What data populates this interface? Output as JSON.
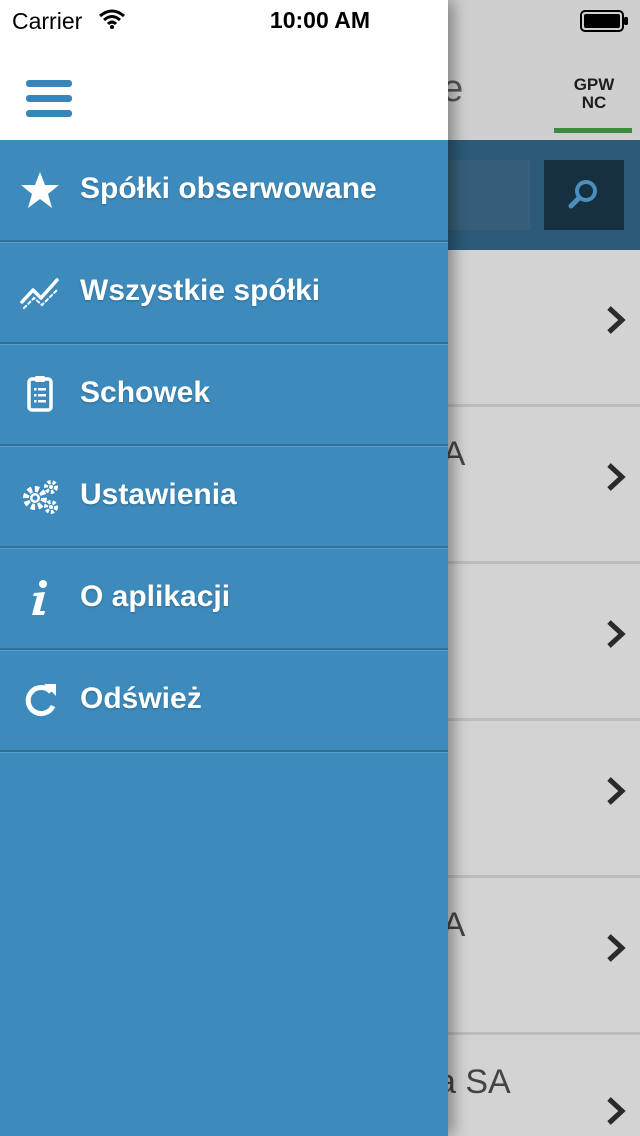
{
  "status_bar": {
    "carrier": "Carrier",
    "time": "10:00 AM"
  },
  "background": {
    "title_fragment": "ne",
    "market_tab": {
      "line1": "GPW",
      "line2": "NC"
    },
    "rows": [
      {
        "name_fragment": ""
      },
      {
        "name_fragment": "SA"
      },
      {
        "name_fragment": ""
      },
      {
        "name_fragment": ""
      },
      {
        "name_fragment": "SA"
      },
      {
        "name_fragment": "ka SA"
      }
    ]
  },
  "drawer": {
    "menu": [
      {
        "icon": "star-icon",
        "label": "Spółki obserwowane"
      },
      {
        "icon": "chart-line-icon",
        "label": "Wszystkie spółki"
      },
      {
        "icon": "clipboard-icon",
        "label": "Schowek"
      },
      {
        "icon": "gears-icon",
        "label": "Ustawienia"
      },
      {
        "icon": "info-icon",
        "label": "O aplikacji"
      },
      {
        "icon": "refresh-icon",
        "label": "Odśwież"
      }
    ]
  },
  "colors": {
    "drawer_bg": "#3d8bbd",
    "accent_green": "#3b8b3f",
    "search_bar": "#2c5a78"
  }
}
